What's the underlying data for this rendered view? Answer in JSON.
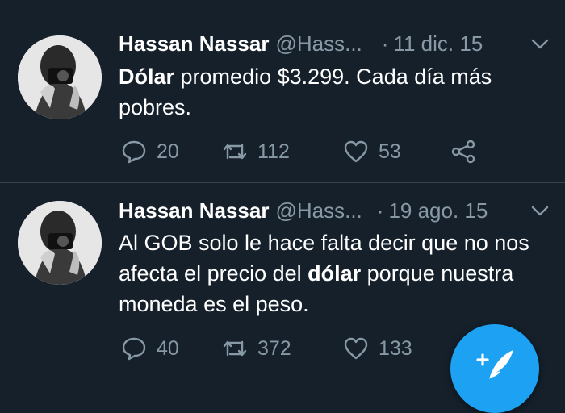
{
  "tweets": [
    {
      "name": "Hassan Nassar",
      "handle": "@Hass...",
      "dot": "·",
      "time": "11 dic. 15",
      "text_bold": "Dólar",
      "text_rest": " promedio $3.299. Cada día más pobres.",
      "replies": "20",
      "retweets": "112",
      "likes": "53"
    },
    {
      "name": "Hassan Nassar",
      "handle": "@Hass...",
      "dot": "·",
      "time": "19 ago. 15",
      "text_pre": "Al GOB solo le hace falta decir que no nos afecta el precio del ",
      "text_bold": "dólar",
      "text_post": " porque nuestra moneda es el peso.",
      "replies": "40",
      "retweets": "372",
      "likes": "133"
    }
  ],
  "icons": {
    "reply": "reply-icon",
    "retweet": "retweet-icon",
    "like": "heart-icon",
    "share": "share-icon",
    "compose": "compose-tweet-icon",
    "caret": "chevron-down-icon"
  },
  "colors": {
    "background": "#15202b",
    "secondary_text": "#8899a6",
    "divider": "#38444d",
    "accent": "#1da1f2"
  }
}
